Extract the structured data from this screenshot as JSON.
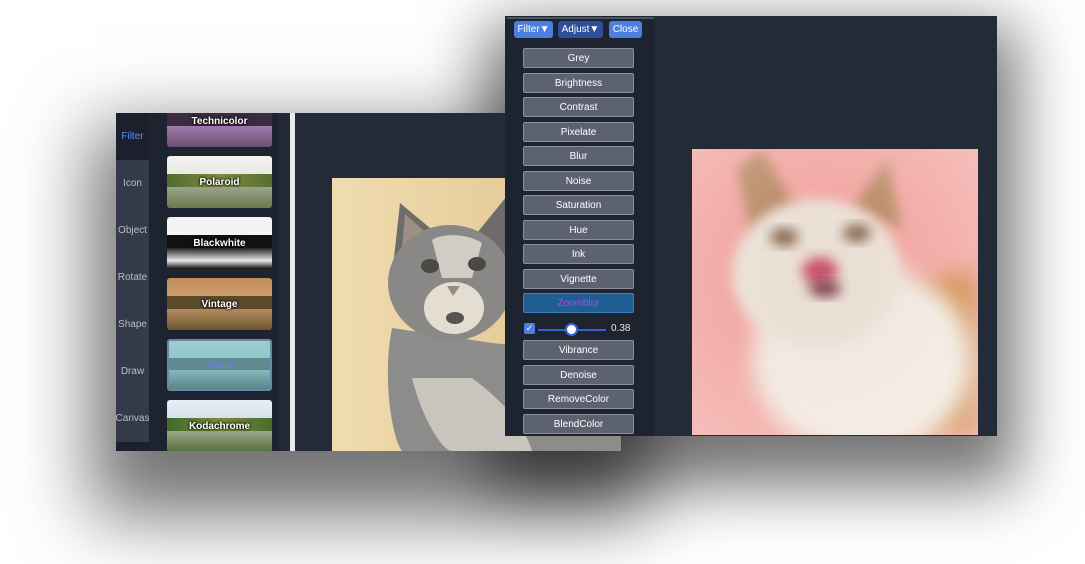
{
  "back_window": {
    "nav": [
      {
        "label": "Filter",
        "active": true
      },
      {
        "label": "Icon",
        "active": false
      },
      {
        "label": "Object",
        "active": false
      },
      {
        "label": "Rotate",
        "active": false
      },
      {
        "label": "Shape",
        "active": false
      },
      {
        "label": "Draw",
        "active": false
      },
      {
        "label": "Canvas",
        "active": false
      }
    ],
    "thumbnails": [
      {
        "label": "Technicolor",
        "selected": false
      },
      {
        "label": "Polaroid",
        "selected": false
      },
      {
        "label": "Blackwhite",
        "selected": false
      },
      {
        "label": "Vintage",
        "selected": false
      },
      {
        "label": "Sepia",
        "selected": true
      },
      {
        "label": "Kodachrome",
        "selected": false
      }
    ]
  },
  "front_window": {
    "top_buttons": {
      "filter": "Filter▼",
      "adjust": "Adjust▼",
      "close": "Close"
    },
    "filters": [
      {
        "label": "Grey"
      },
      {
        "label": "Brightness"
      },
      {
        "label": "Contrast"
      },
      {
        "label": "Pixelate"
      },
      {
        "label": "Blur"
      },
      {
        "label": "Noise"
      },
      {
        "label": "Saturation"
      },
      {
        "label": "Hue"
      },
      {
        "label": "Ink"
      },
      {
        "label": "Vignette"
      },
      {
        "label": "Zoomblur",
        "active": true
      }
    ],
    "zoomblur_slider": {
      "enabled": true,
      "value": "0.38",
      "fraction": 0.38
    },
    "filters_after": [
      {
        "label": "Vibrance"
      },
      {
        "label": "Denoise"
      },
      {
        "label": "RemoveColor"
      },
      {
        "label": "BlendColor"
      }
    ]
  },
  "colors": {
    "accent": "#4c7fe0",
    "active_filter_text": "#c23df0",
    "panel_bg": "#1e2330",
    "canvas_bg": "#232a38",
    "photo_bg_front": "#f09a95"
  },
  "icons": [
    "dropdown-arrow-icon",
    "checkbox-checked-icon"
  ]
}
